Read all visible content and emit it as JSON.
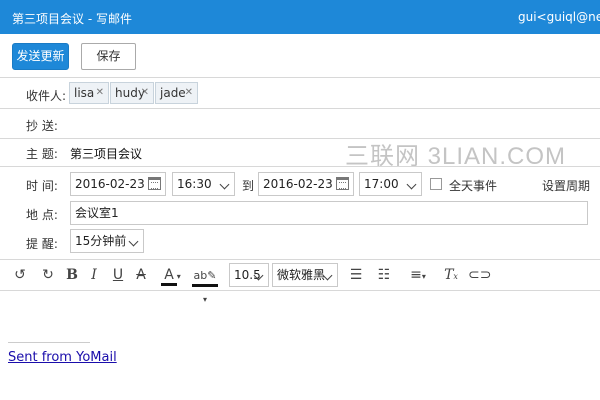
{
  "window": {
    "title": "第三项目会议  -  写邮件",
    "account": "gui<guiql@nexted"
  },
  "toolbar_top": {
    "send_label": "发送更新",
    "save_label": "保存"
  },
  "recipients": {
    "to_label": "收件人:",
    "to_chips": [
      "lisa",
      "hudy",
      "jade"
    ],
    "cc_label": "抄  送:"
  },
  "subject": {
    "label": "主  题:",
    "value": "第三项目会议"
  },
  "time": {
    "label": "时  间:",
    "start_date": "2016-02-23",
    "start_time": "16:30",
    "to_label": "到",
    "end_date": "2016-02-23",
    "end_time": "17:00",
    "all_day_label": "全天事件",
    "all_day_checked": false,
    "recurrence_label": "设置周期"
  },
  "location": {
    "label": "地  点:",
    "value": "会议室1"
  },
  "reminder": {
    "label": "提  醒:",
    "value": "15分钟前"
  },
  "editor_toolbar": {
    "font_size": "10.5",
    "font_family": "微软雅黑",
    "icons": [
      "undo-icon",
      "redo-icon",
      "bold-icon",
      "italic-icon",
      "underline-icon",
      "strikethrough-icon",
      "font-color-icon",
      "highlight-icon",
      "numbered-list-icon",
      "bullet-list-icon",
      "align-icon",
      "clear-format-icon",
      "link-icon"
    ]
  },
  "body": {
    "signature_link": "Sent from YoMail"
  },
  "watermark": "三联网 3LIAN.COM",
  "colors": {
    "accent": "#1e88d8",
    "chip_bg": "#eef2f6",
    "divider": "#d8d8d8",
    "link": "#1a0dab"
  }
}
